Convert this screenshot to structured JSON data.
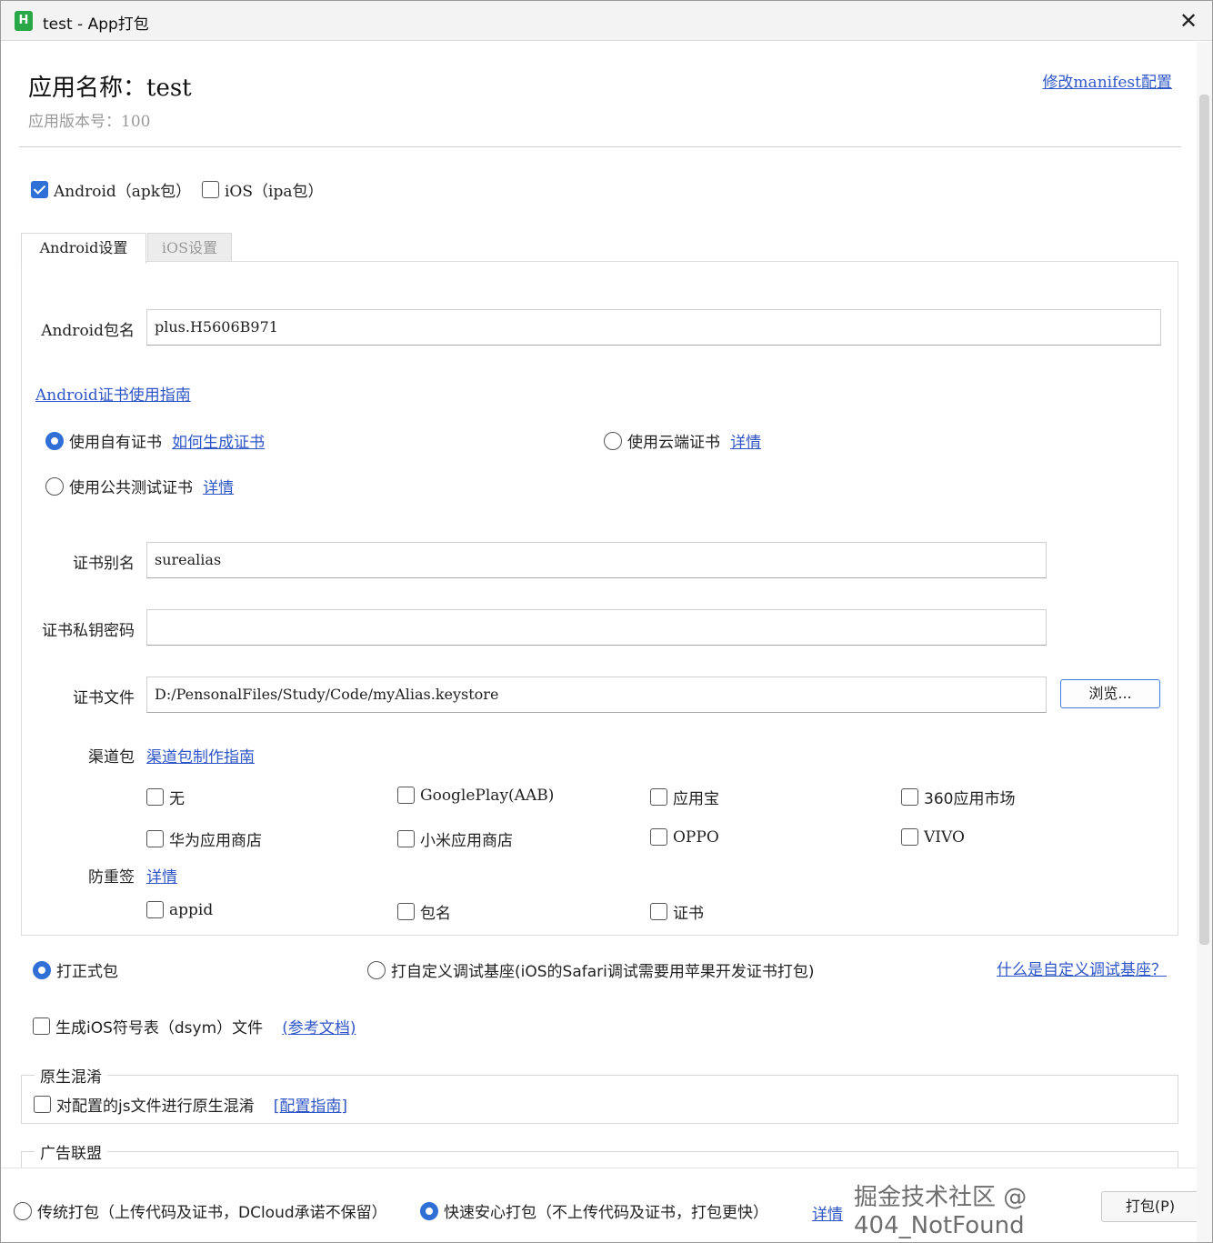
{
  "window": {
    "title": "test - App打包",
    "icon_letter": "H",
    "close_glyph": "✕"
  },
  "header": {
    "app_name": "应用名称：test",
    "app_version": "应用版本号：100",
    "manifest_link": "修改manifest配置"
  },
  "platforms": {
    "android": {
      "label": "Android（apk包）",
      "checked": true
    },
    "ios": {
      "label": "iOS（ipa包）",
      "checked": false
    }
  },
  "tabs": [
    {
      "label": "Android设置",
      "active": true
    },
    {
      "label": "iOS设置",
      "active": false
    }
  ],
  "android": {
    "package_label": "Android包名",
    "package_value": "plus.H5606B971",
    "cert_guide_link": "Android证书使用指南",
    "cert_options": {
      "own": {
        "label": "使用自有证书",
        "link": "如何生成证书",
        "checked": true
      },
      "cloud": {
        "label": "使用云端证书",
        "link": "详情",
        "checked": false
      },
      "public": {
        "label": "使用公共测试证书",
        "link": "详情",
        "checked": false
      }
    },
    "alias_label": "证书别名",
    "alias_value": "surealias",
    "password_label": "证书私钥密码",
    "password_value": "",
    "file_label": "证书文件",
    "file_value": "D:/PensonalFiles/Study/Code/myAlias.keystore",
    "browse_label": "浏览...",
    "channel_label": "渠道包",
    "channel_link": "渠道包制作指南",
    "channels": [
      "无",
      "GooglePlay(AAB)",
      "应用宝",
      "360应用市场",
      "华为应用商店",
      "小米应用商店",
      "OPPO",
      "VIVO"
    ],
    "anti_label": "防重签",
    "anti_link": "详情",
    "anti_options": [
      "appid",
      "包名",
      "证书"
    ]
  },
  "build_type": {
    "formal": {
      "label": "打正式包",
      "checked": true
    },
    "custom": {
      "label": "打自定义调试基座(iOS的Safari调试需要用苹果开发证书打包)",
      "checked": false
    },
    "custom_link": "什么是自定义调试基座？"
  },
  "dsym": {
    "label": "生成iOS符号表（dsym）文件",
    "link": "(参考文档)",
    "checked": false
  },
  "obfuscation": {
    "legend": "原生混淆",
    "label": "对配置的js文件进行原生混淆",
    "link": "[配置指南]",
    "checked": false
  },
  "ads": {
    "legend": "广告联盟"
  },
  "bottom": {
    "traditional": {
      "label": "传统打包（上传代码及证书，DCloud承诺不保留）",
      "checked": false
    },
    "fast": {
      "label": "快速安心打包（不上传代码及证书，打包更快）",
      "checked": true
    },
    "details_link": "详情",
    "pack_button": "打包(P)",
    "watermark": "掘金技术社区 @ 404_NotFound"
  }
}
